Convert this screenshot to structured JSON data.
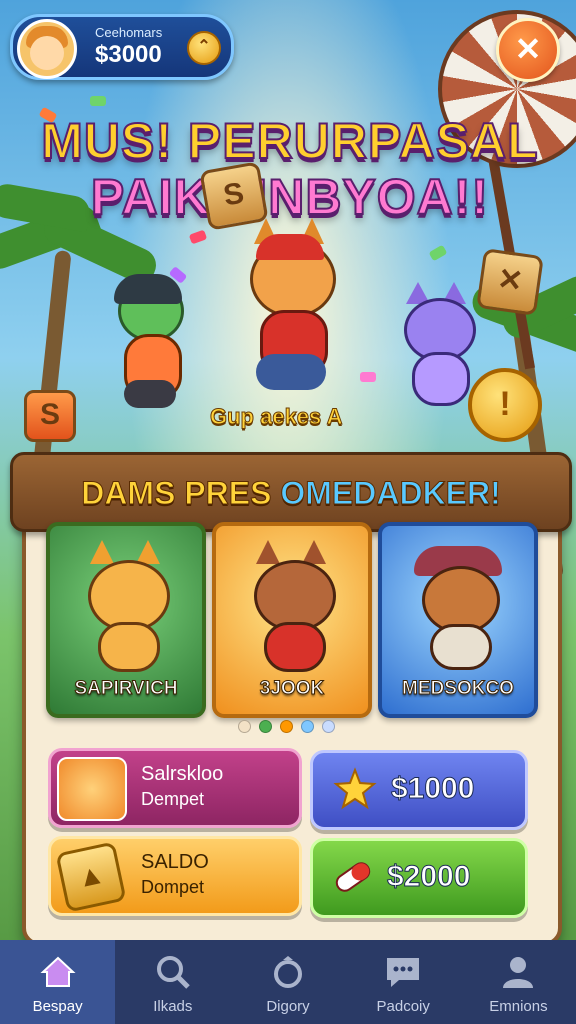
{
  "profile": {
    "name": "Ceehomars",
    "balance": "$3000",
    "coin_symbol": "⌃"
  },
  "close_symbol": "✕",
  "title": {
    "line1": "MUS! PERURPASAL",
    "line2": "PAIK MNBYOA!!"
  },
  "subcaption": "Gup aekes A",
  "big_coin_symbol": "!",
  "dice_symbols": [
    "S",
    "✕",
    "S"
  ],
  "banner": {
    "part1": "DAMS PRES ",
    "part2": "OMEDADKER!"
  },
  "cards": [
    {
      "name": "SAPIRVICH"
    },
    {
      "name": "3JOOK"
    },
    {
      "name": "MEDSOKCO"
    }
  ],
  "carousel_dots": [
    "#f3e2c6",
    "#4caf50",
    "#ff9800",
    "#7fc7ff",
    "#c9dcff"
  ],
  "buttons": {
    "wallet1": {
      "line1": "Salrskloo",
      "line2": "Dempet"
    },
    "price1": {
      "value": "$1000"
    },
    "wallet2": {
      "line1": "SALDO",
      "line2": "Dompet",
      "icon_symbol": "▲"
    },
    "price2": {
      "value": "$2000"
    }
  },
  "tabs": [
    {
      "label": "Bespay",
      "icon": "home-icon",
      "active": true
    },
    {
      "label": "Ilkads",
      "icon": "search-icon",
      "active": false
    },
    {
      "label": "Digory",
      "icon": "ring-icon",
      "active": false
    },
    {
      "label": "Padcoiy",
      "icon": "chat-icon",
      "active": false
    },
    {
      "label": "Emnions",
      "icon": "person-icon",
      "active": false
    }
  ],
  "colors": {
    "accent_yellow": "#ffd33a",
    "accent_blue": "#59c9ff",
    "panel": "#f7ecd6",
    "tabbar": "#2a3a66"
  }
}
